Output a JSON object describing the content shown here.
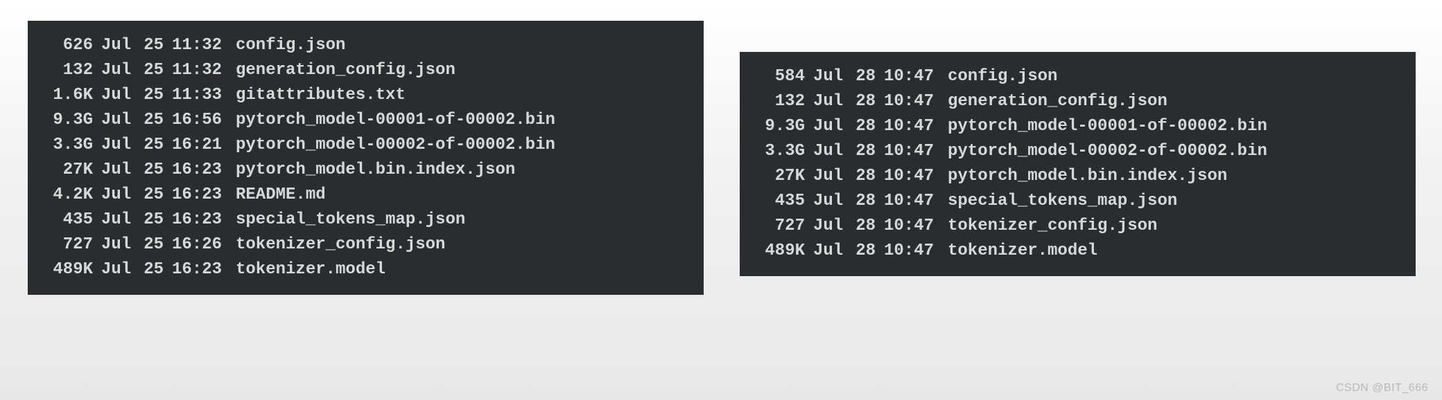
{
  "left_listing": [
    {
      "size": "626",
      "month": "Jul",
      "day": "25",
      "time": "11:32",
      "filename": "config.json"
    },
    {
      "size": "132",
      "month": "Jul",
      "day": "25",
      "time": "11:32",
      "filename": "generation_config.json"
    },
    {
      "size": "1.6K",
      "month": "Jul",
      "day": "25",
      "time": "11:33",
      "filename": "gitattributes.txt"
    },
    {
      "size": "9.3G",
      "month": "Jul",
      "day": "25",
      "time": "16:56",
      "filename": "pytorch_model-00001-of-00002.bin"
    },
    {
      "size": "3.3G",
      "month": "Jul",
      "day": "25",
      "time": "16:21",
      "filename": "pytorch_model-00002-of-00002.bin"
    },
    {
      "size": "27K",
      "month": "Jul",
      "day": "25",
      "time": "16:23",
      "filename": "pytorch_model.bin.index.json"
    },
    {
      "size": "4.2K",
      "month": "Jul",
      "day": "25",
      "time": "16:23",
      "filename": "README.md"
    },
    {
      "size": "435",
      "month": "Jul",
      "day": "25",
      "time": "16:23",
      "filename": "special_tokens_map.json"
    },
    {
      "size": "727",
      "month": "Jul",
      "day": "25",
      "time": "16:26",
      "filename": "tokenizer_config.json"
    },
    {
      "size": "489K",
      "month": "Jul",
      "day": "25",
      "time": "16:23",
      "filename": "tokenizer.model"
    }
  ],
  "right_listing": [
    {
      "size": "584",
      "month": "Jul",
      "day": "28",
      "time": "10:47",
      "filename": "config.json"
    },
    {
      "size": "132",
      "month": "Jul",
      "day": "28",
      "time": "10:47",
      "filename": "generation_config.json"
    },
    {
      "size": "9.3G",
      "month": "Jul",
      "day": "28",
      "time": "10:47",
      "filename": "pytorch_model-00001-of-00002.bin"
    },
    {
      "size": "3.3G",
      "month": "Jul",
      "day": "28",
      "time": "10:47",
      "filename": "pytorch_model-00002-of-00002.bin"
    },
    {
      "size": "27K",
      "month": "Jul",
      "day": "28",
      "time": "10:47",
      "filename": "pytorch_model.bin.index.json"
    },
    {
      "size": "435",
      "month": "Jul",
      "day": "28",
      "time": "10:47",
      "filename": "special_tokens_map.json"
    },
    {
      "size": "727",
      "month": "Jul",
      "day": "28",
      "time": "10:47",
      "filename": "tokenizer_config.json"
    },
    {
      "size": "489K",
      "month": "Jul",
      "day": "28",
      "time": "10:47",
      "filename": "tokenizer.model"
    }
  ],
  "watermark": "CSDN @BIT_666"
}
